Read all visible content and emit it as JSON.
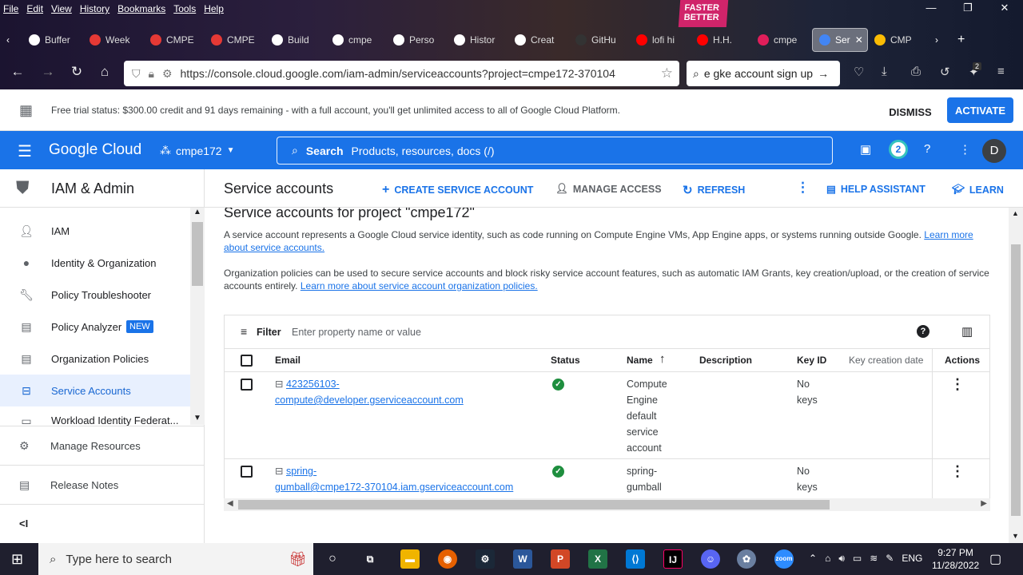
{
  "browser": {
    "menu": [
      "File",
      "Edit",
      "View",
      "History",
      "Bookmarks",
      "Tools",
      "Help"
    ],
    "neon_sign": "FASTER BETTER",
    "tabs": [
      {
        "label": "Buffer",
        "color": "#ffffff"
      },
      {
        "label": "Week",
        "color": "#e53935"
      },
      {
        "label": "CMPE",
        "color": "#e53935"
      },
      {
        "label": "CMPE",
        "color": "#e53935"
      },
      {
        "label": "Build",
        "color": "#ffffff"
      },
      {
        "label": "cmpe",
        "color": "#ffffff"
      },
      {
        "label": "Perso",
        "color": "#ffffff"
      },
      {
        "label": "Histor",
        "color": "#ffffff"
      },
      {
        "label": "Creat",
        "color": "#ffffff"
      },
      {
        "label": "GitHu",
        "color": "#333333"
      },
      {
        "label": "lofi hi",
        "color": "#ff0000"
      },
      {
        "label": "H.H.",
        "color": "#ff0000"
      },
      {
        "label": "cmpe",
        "color": "#e01e5a"
      },
      {
        "label": "Ser",
        "color": "#4285f4"
      },
      {
        "label": "CMP",
        "color": "#fbbc04"
      }
    ],
    "url": "https://console.cloud.google.com/iam-admin/serviceaccounts?project=cmpe172-370104",
    "search_value": "e gke account sign up",
    "badge_count": "2"
  },
  "trial": {
    "message": "Free trial status: $300.00 credit and 91 days remaining - with a full account, you'll get unlimited access to all of Google Cloud Platform.",
    "dismiss": "DISMISS",
    "activate": "ACTIVATE"
  },
  "topbar": {
    "logo": "Google Cloud",
    "project": "cmpe172",
    "search_label": "Search",
    "search_placeholder": "Products, resources, docs (/)",
    "notifications": "2",
    "avatar_initial": "D"
  },
  "sidebar": {
    "title": "IAM & Admin",
    "items": [
      {
        "label": "IAM",
        "icon": "person-add-icon"
      },
      {
        "label": "Identity & Organization",
        "icon": "account-circle-icon"
      },
      {
        "label": "Policy Troubleshooter",
        "icon": "wrench-icon"
      },
      {
        "label": "Policy Analyzer",
        "icon": "doc-search-icon",
        "badge": "NEW"
      },
      {
        "label": "Organization Policies",
        "icon": "list-icon"
      },
      {
        "label": "Service Accounts",
        "icon": "service-account-icon",
        "selected": true
      },
      {
        "label": "Workload Identity Federat...",
        "icon": "id-card-icon"
      }
    ],
    "bottom": [
      {
        "label": "Manage Resources"
      },
      {
        "label": "Release Notes"
      }
    ],
    "collapse": "<I"
  },
  "toolbar": {
    "title": "Service accounts",
    "create": "CREATE SERVICE ACCOUNT",
    "manage": "MANAGE ACCESS",
    "refresh": "REFRESH",
    "help": "HELP ASSISTANT",
    "learn": "LEARN"
  },
  "content": {
    "heading": "Service accounts for project \"cmpe172\"",
    "desc1": "A service account represents a Google Cloud service identity, such as code running on Compute Engine VMs, App Engine apps, or systems running outside Google.",
    "desc1_link_a": "Learn more",
    "desc1_link_b": "about service accounts.",
    "desc2": "Organization policies can be used to secure service accounts and block risky service account features, such as automatic IAM Grants, key creation/upload, or the creation of service",
    "desc2_b": "accounts entirely.",
    "desc2_link": "Learn more about service account organization policies."
  },
  "table": {
    "filter_label": "Filter",
    "filter_placeholder": "Enter property name or value",
    "columns": [
      "Email",
      "Status",
      "Name",
      "Description",
      "Key ID",
      "Key creation date",
      "Actions"
    ],
    "rows": [
      {
        "email_a": "423256103-",
        "email_b": "compute@developer.gserviceaccount.com",
        "name": [
          "Compute",
          "Engine",
          "default",
          "service",
          "account"
        ],
        "key_id": [
          "No",
          "keys"
        ]
      },
      {
        "email_a": "spring-",
        "email_b": "gumball@cmpe172-370104.iam.gserviceaccount.com",
        "name": [
          "spring-",
          "gumball"
        ],
        "key_id": [
          "No",
          "keys"
        ]
      }
    ]
  },
  "taskbar": {
    "search_placeholder": "Type here to search",
    "lang": "ENG",
    "time": "9:27 PM",
    "date": "11/28/2022"
  }
}
